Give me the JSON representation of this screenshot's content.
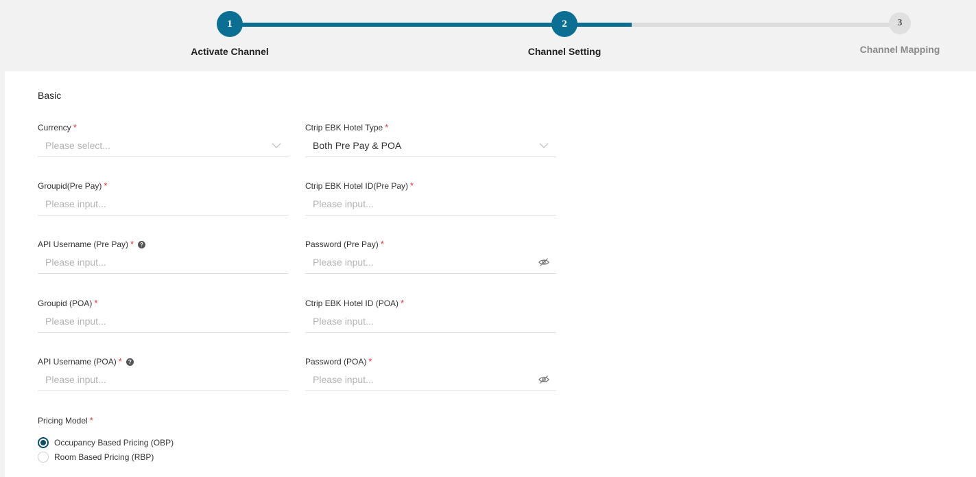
{
  "stepper": {
    "steps": [
      {
        "number": "1",
        "label": "Activate Channel",
        "state": "completed"
      },
      {
        "number": "2",
        "label": "Channel Setting",
        "state": "current"
      },
      {
        "number": "3",
        "label": "Channel Mapping",
        "state": "upcoming"
      }
    ],
    "colors": {
      "active": "#0b6f94",
      "inactive": "#dcdcdc"
    }
  },
  "form": {
    "section_title": "Basic",
    "required_mark": "*",
    "help_mark": "?",
    "fields": {
      "currency": {
        "label": "Currency",
        "placeholder": "Please select...",
        "type": "select"
      },
      "hotel_type": {
        "label": "Ctrip EBK Hotel Type",
        "value": "Both Pre Pay & POA",
        "type": "select"
      },
      "groupid_prepay": {
        "label": "Groupid(Pre Pay)",
        "placeholder": "Please input..."
      },
      "hotel_id_prepay": {
        "label": "Ctrip EBK Hotel ID(Pre Pay)",
        "placeholder": "Please input..."
      },
      "api_username_prepay": {
        "label": "API Username (Pre Pay)",
        "placeholder": "Please input...",
        "help": true
      },
      "password_prepay": {
        "label": "Password (Pre Pay)",
        "placeholder": "Please input...",
        "type": "password"
      },
      "groupid_poa": {
        "label": "Groupid (POA)",
        "placeholder": "Please input..."
      },
      "hotel_id_poa": {
        "label": "Ctrip EBK Hotel ID (POA)",
        "placeholder": "Please input..."
      },
      "api_username_poa": {
        "label": "API Username (POA)",
        "placeholder": "Please input...",
        "help": true
      },
      "password_poa": {
        "label": "Password (POA)",
        "placeholder": "Please input...",
        "type": "password"
      }
    },
    "pricing_model": {
      "label": "Pricing Model",
      "options": [
        {
          "label": "Occupancy Based Pricing (OBP)",
          "checked": true
        },
        {
          "label": "Room Based Pricing (RBP)",
          "checked": false
        }
      ]
    }
  },
  "icons": {
    "select_suffix": "chevron-down-icon",
    "password_suffix": "eye-slash-icon",
    "help": "question-circle-icon"
  }
}
